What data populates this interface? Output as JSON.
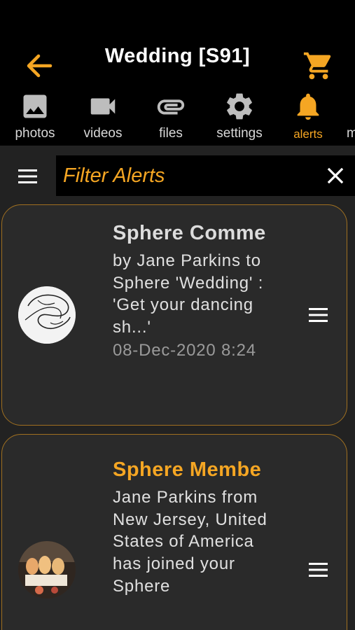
{
  "header": {
    "title": "Wedding [S91]",
    "back_icon": "arrow-left-icon",
    "cart_icon": "cart-icon",
    "accent_color": "#f5a623"
  },
  "tabs": [
    {
      "label": "photos",
      "icon": "image-icon",
      "active": false
    },
    {
      "label": "videos",
      "icon": "video-camera-icon",
      "active": false
    },
    {
      "label": "files",
      "icon": "paperclip-icon",
      "active": false
    },
    {
      "label": "settings",
      "icon": "gear-icon",
      "active": false
    },
    {
      "label": "alerts",
      "icon": "bell-icon",
      "active": true
    },
    {
      "label": "m",
      "icon": "",
      "active": false
    }
  ],
  "filter": {
    "placeholder": "Filter Alerts",
    "value": ""
  },
  "alerts": [
    {
      "title": "Sphere Comme",
      "title_color": "#dcdcdc",
      "body": "by Jane Parkins to Sphere 'Wedding' : 'Get your dancing sh...'",
      "date": "08-Dec-2020  8:24"
    },
    {
      "title": "Sphere Membe",
      "title_color": "#f5a623",
      "body": "Jane Parkins from New Jersey, United States of America has joined your Sphere",
      "date": ""
    }
  ]
}
